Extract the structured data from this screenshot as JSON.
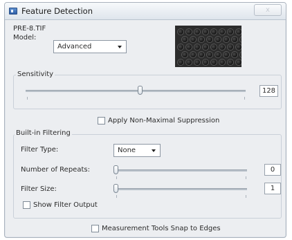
{
  "window": {
    "title": "Feature Detection",
    "close_label": "x"
  },
  "file": {
    "name": "PRE-8.TIF"
  },
  "model": {
    "label": "Model:",
    "value": "Advanced"
  },
  "sensitivity": {
    "label": "Sensitivity",
    "value": "128",
    "level_fraction": 0.5
  },
  "nms": {
    "label": "Apply Non-Maximal Suppression",
    "checked": false
  },
  "builtin_filtering": {
    "label": "Built-in Filtering",
    "filter_type": {
      "label": "Filter Type:",
      "value": "None"
    },
    "repeats": {
      "label": "Number of Repeats:",
      "value": "0",
      "level_fraction": 0.0
    },
    "filter_size": {
      "label": "Filter Size:",
      "value": "1",
      "level_fraction": 0.0
    },
    "show_output": {
      "label": "Show Filter Output",
      "checked": false
    }
  },
  "snap": {
    "label": "Measurement Tools Snap to Edges",
    "checked": false
  },
  "colors": {
    "window_bg": "#eceef1",
    "preview_bg": "#2c2c2c"
  },
  "icons": [
    "app-icon",
    "close-icon",
    "chevron-down-icon"
  ]
}
